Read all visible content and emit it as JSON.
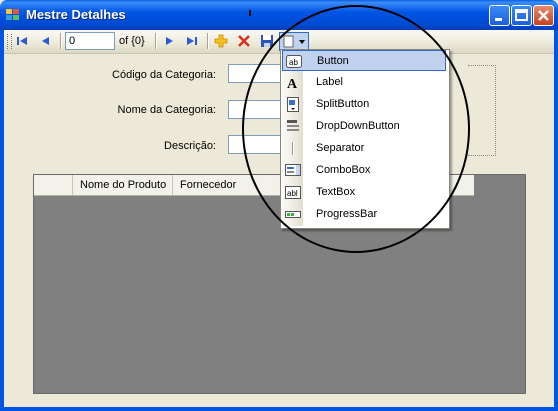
{
  "window": {
    "title": "Mestre Detalhes",
    "title_color": "#FFFFFF",
    "titlebar_color": "#0055E5",
    "buttons": [
      "minimize",
      "maximize",
      "close"
    ]
  },
  "navigator": {
    "position_value": "0",
    "count_text": "of {0}",
    "icons": [
      "move-first-icon",
      "move-previous-icon",
      "move-next-icon",
      "move-last-icon",
      "add-new-icon",
      "delete-icon",
      "save-icon",
      "add-toolstrip-item-icon"
    ]
  },
  "form": {
    "codigo_label": "Código da Categoria:",
    "nome_label": "Nome da Categoria:",
    "descricao_label": "Descrição:"
  },
  "grid": {
    "columns": [
      "Nome do Produto",
      "Fornecedor"
    ],
    "background": "#808080"
  },
  "dropdown": {
    "items": [
      {
        "label": "Button",
        "icon": "button-icon"
      },
      {
        "label": "Label",
        "icon": "label-icon"
      },
      {
        "label": "SplitButton",
        "icon": "splitbutton-icon"
      },
      {
        "label": "DropDownButton",
        "icon": "dropdownbutton-icon"
      },
      {
        "label": "Separator",
        "icon": "separator-icon"
      },
      {
        "label": "ComboBox",
        "icon": "combobox-icon"
      },
      {
        "label": "TextBox",
        "icon": "textbox-icon"
      },
      {
        "label": "ProgressBar",
        "icon": "progressbar-icon"
      }
    ],
    "highlight_color": "#C1D2EE"
  }
}
